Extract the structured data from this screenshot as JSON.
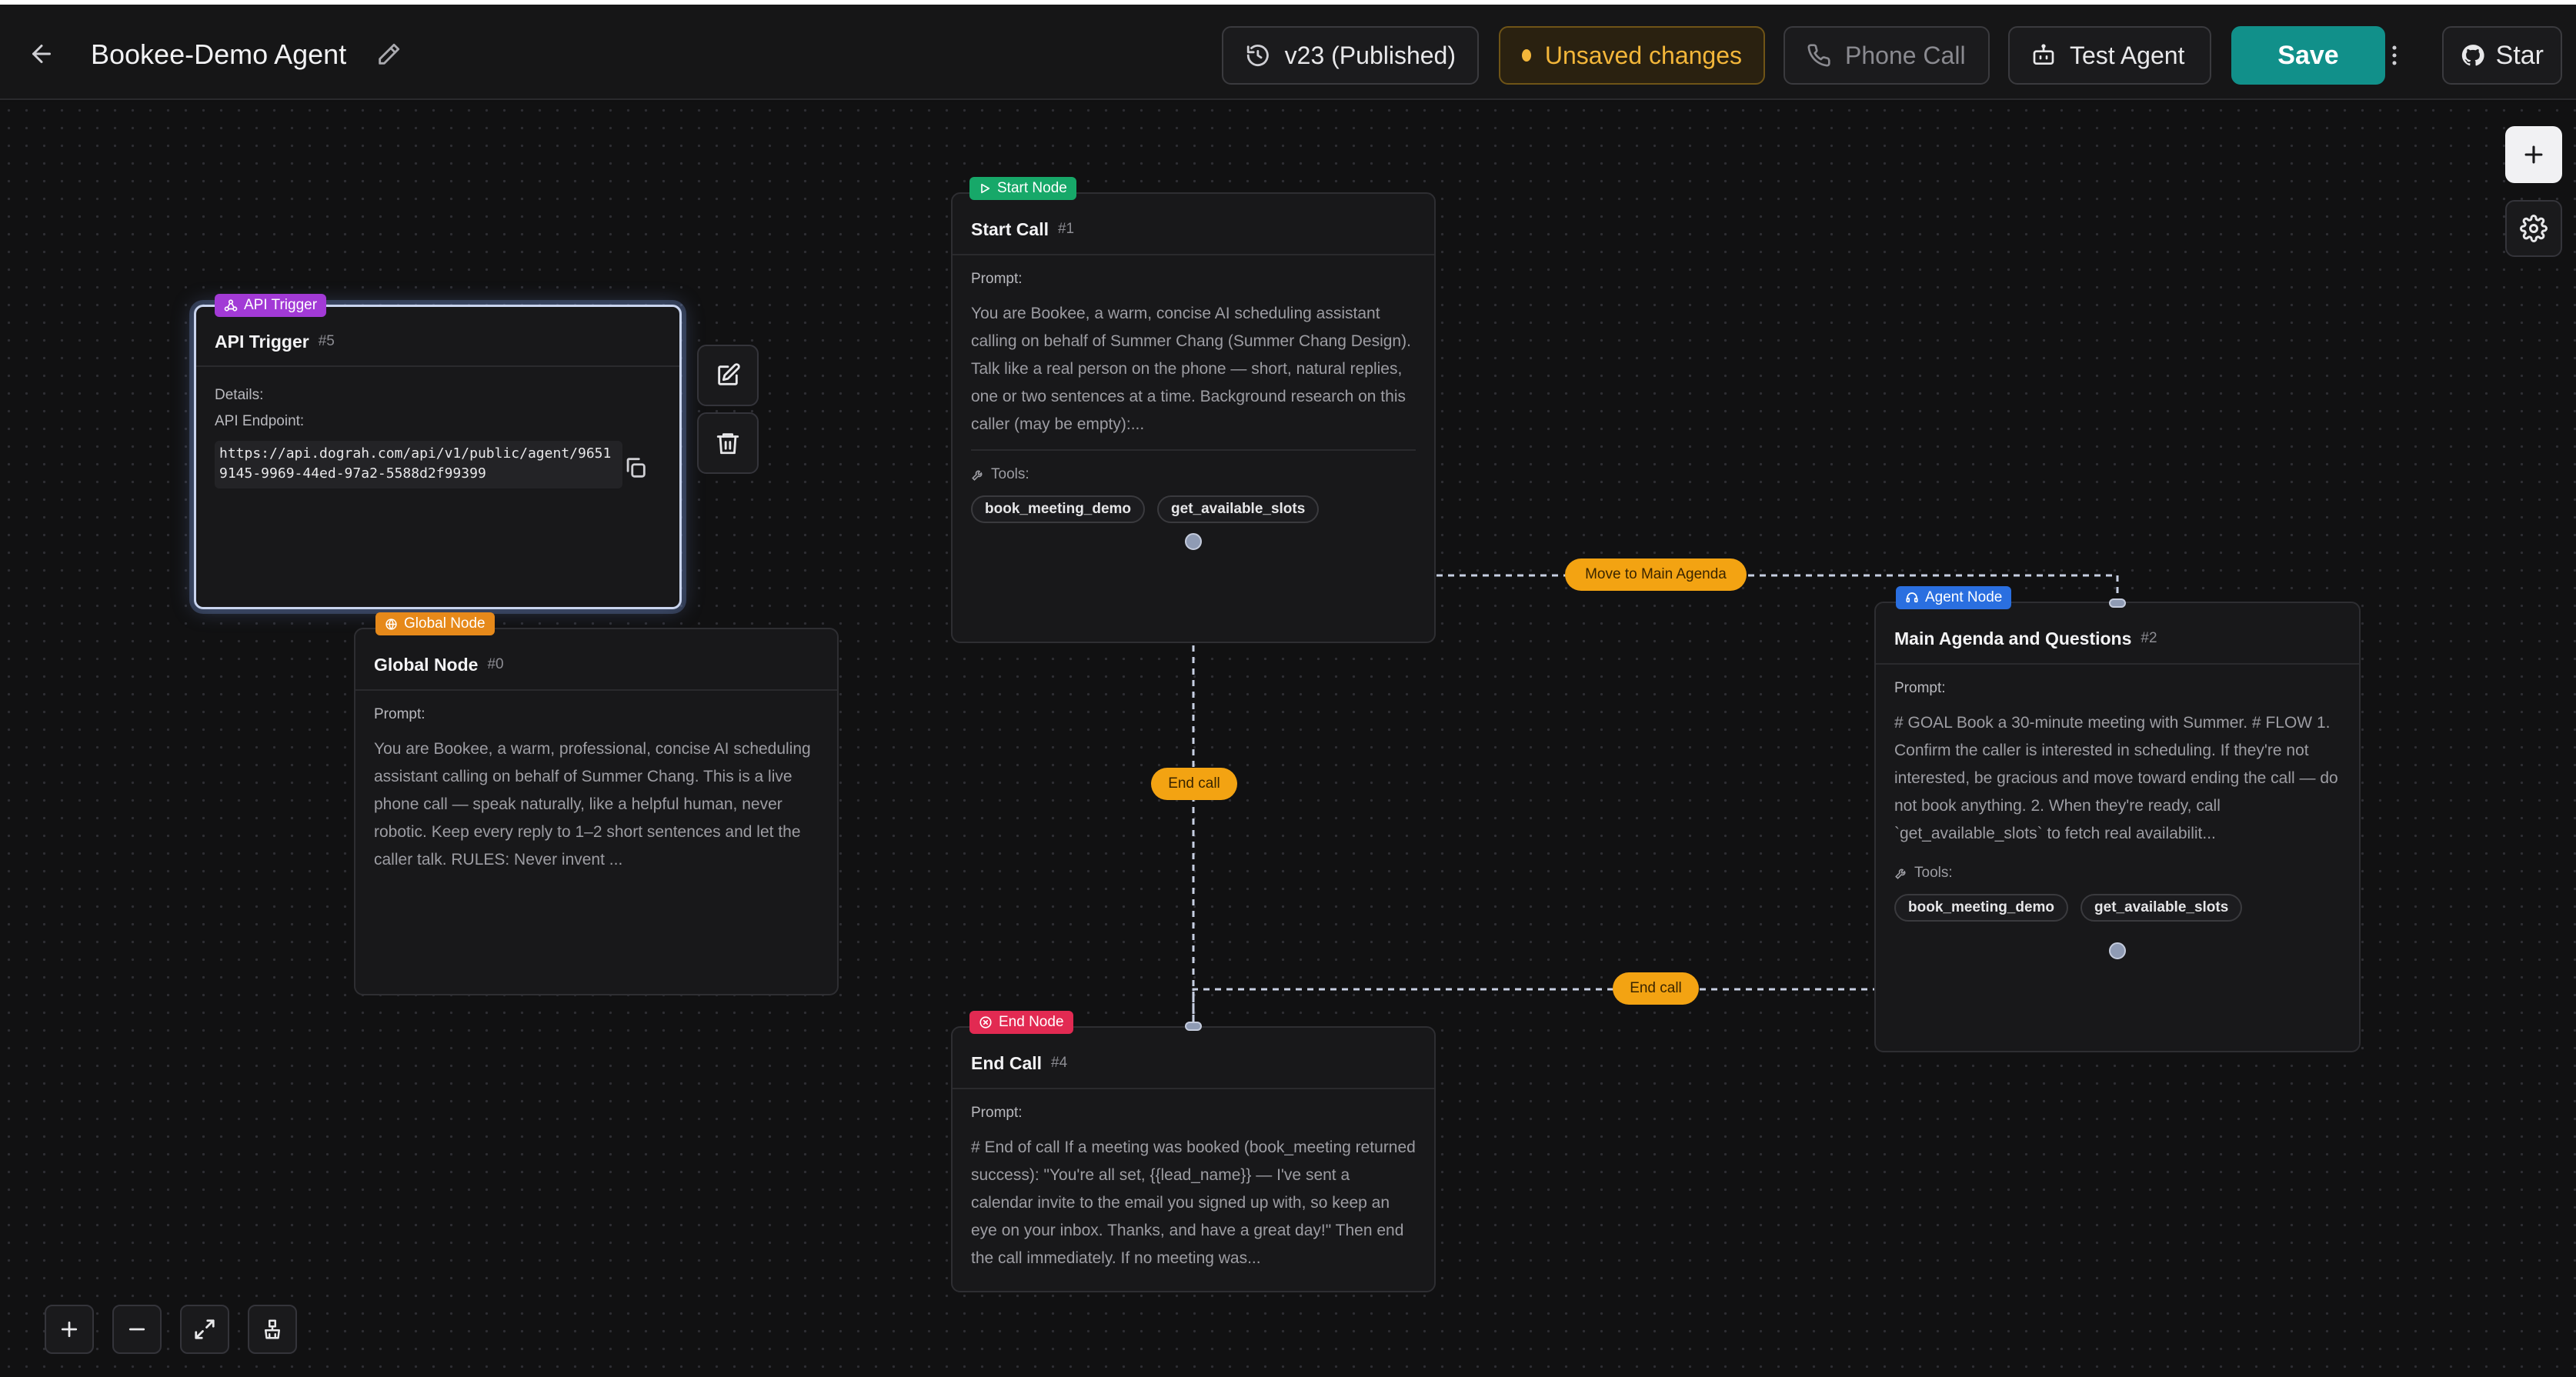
{
  "header": {
    "title": "Bookee-Demo Agent",
    "version": "v23 (Published)",
    "unsaved": "Unsaved changes",
    "phone_call": "Phone Call",
    "test_agent": "Test Agent",
    "save": "Save",
    "star": "Star"
  },
  "nodes": {
    "start": {
      "badge": "Start Node",
      "title": "Start Call",
      "num": "#1",
      "prompt_label": "Prompt:",
      "prompt": "You are Bookee, a warm, concise AI scheduling assistant calling on behalf of Summer Chang (Summer Chang Design). Talk like a real person on the phone — short, natural replies, one or two sentences at a time. Background research on this caller (may be empty):...",
      "tools_label": "Tools:",
      "tools": [
        "book_meeting_demo",
        "get_available_slots"
      ]
    },
    "api": {
      "badge": "API Trigger",
      "title": "API Trigger",
      "num": "#5",
      "details_label": "Details:",
      "endpoint_label": "API Endpoint:",
      "endpoint": "https://api.dograh.com/api/v1/public/agent/96519145-9969-44ed-97a2-5588d2f99399"
    },
    "global": {
      "badge": "Global Node",
      "title": "Global Node",
      "num": "#0",
      "prompt_label": "Prompt:",
      "prompt": "You are Bookee, a warm, professional, concise AI scheduling assistant calling on behalf of Summer Chang. This is a live phone call — speak naturally, like a helpful human, never robotic. Keep every reply to 1–2 short sentences and let the caller talk. RULES: Never invent ..."
    },
    "agent": {
      "badge": "Agent Node",
      "title": "Main Agenda and Questions",
      "num": "#2",
      "prompt_label": "Prompt:",
      "prompt": "# GOAL Book a 30-minute meeting with Summer. # FLOW 1. Confirm the caller is interested in scheduling. If they're not interested, be gracious and move toward ending the call — do not book anything. 2. When they're ready, call `get_available_slots` to fetch real availabilit...",
      "tools_label": "Tools:",
      "tools": [
        "book_meeting_demo",
        "get_available_slots"
      ]
    },
    "end": {
      "badge": "End Node",
      "title": "End Call",
      "num": "#4",
      "prompt_label": "Prompt:",
      "prompt": "# End of call If a meeting was booked (book_meeting returned success): \"You're all set, {{lead_name}} — I've sent a calendar invite to the email you signed up with, so keep an eye on your inbox. Thanks, and have a great day!\" Then end the call immediately. If no meeting was..."
    }
  },
  "edges": {
    "move_to_main": "Move to Main Agenda",
    "end_call_1": "End call",
    "end_call_2": "End call"
  },
  "icons": {
    "back": "arrow-left-icon",
    "edit": "pencil-icon",
    "history": "history-icon",
    "phone": "phone-icon",
    "bot": "bot-icon",
    "more": "more-vertical-icon",
    "github": "github-icon",
    "add": "plus-icon",
    "settings": "gear-icon",
    "zoom_in": "plus-icon",
    "zoom_out": "minus-icon",
    "fit": "expand-icon",
    "clean": "brush-icon"
  },
  "colors": {
    "save": "#11908a",
    "unsaved": "#f3b63a",
    "edge_label": "#f3a312",
    "start_badge": "#17a869",
    "api_badge": "#a23ad6",
    "global_badge": "#e6891a",
    "agent_badge": "#2a6fe0",
    "end_badge": "#e22a52"
  }
}
